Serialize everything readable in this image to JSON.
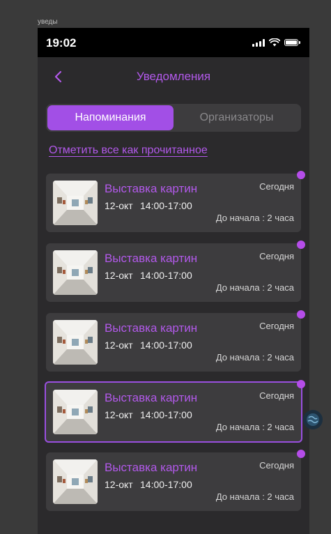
{
  "frame_label": "уведы",
  "status_bar": {
    "time": "19:02"
  },
  "header": {
    "title": "Уведомления"
  },
  "tabs": [
    {
      "label": "Напоминания",
      "active": true
    },
    {
      "label": "Организаторы",
      "active": false
    }
  ],
  "mark_all_label": "Отметить все как прочитанное",
  "notifications": [
    {
      "title": "Выставка картин",
      "date": "12-окт",
      "time": "14:00-17:00",
      "day": "Сегодня",
      "starts_in": "До начала : 2 часа",
      "unread": true,
      "selected": false
    },
    {
      "title": "Выставка картин",
      "date": "12-окт",
      "time": "14:00-17:00",
      "day": "Сегодня",
      "starts_in": "До начала : 2 часа",
      "unread": true,
      "selected": false
    },
    {
      "title": "Выставка картин",
      "date": "12-окт",
      "time": "14:00-17:00",
      "day": "Сегодня",
      "starts_in": "До начала : 2 часа",
      "unread": true,
      "selected": false
    },
    {
      "title": "Выставка картин",
      "date": "12-окт",
      "time": "14:00-17:00",
      "day": "Сегодня",
      "starts_in": "До начала : 2 часа",
      "unread": true,
      "selected": true
    },
    {
      "title": "Выставка картин",
      "date": "12-окт",
      "time": "14:00-17:00",
      "day": "Сегодня",
      "starts_in": "До начала : 2 часа",
      "unread": true,
      "selected": false
    }
  ],
  "colors": {
    "accent": "#a24fe6",
    "title": "#b259ea",
    "background": "#2b2a2c",
    "card": "#3d3c3e"
  }
}
